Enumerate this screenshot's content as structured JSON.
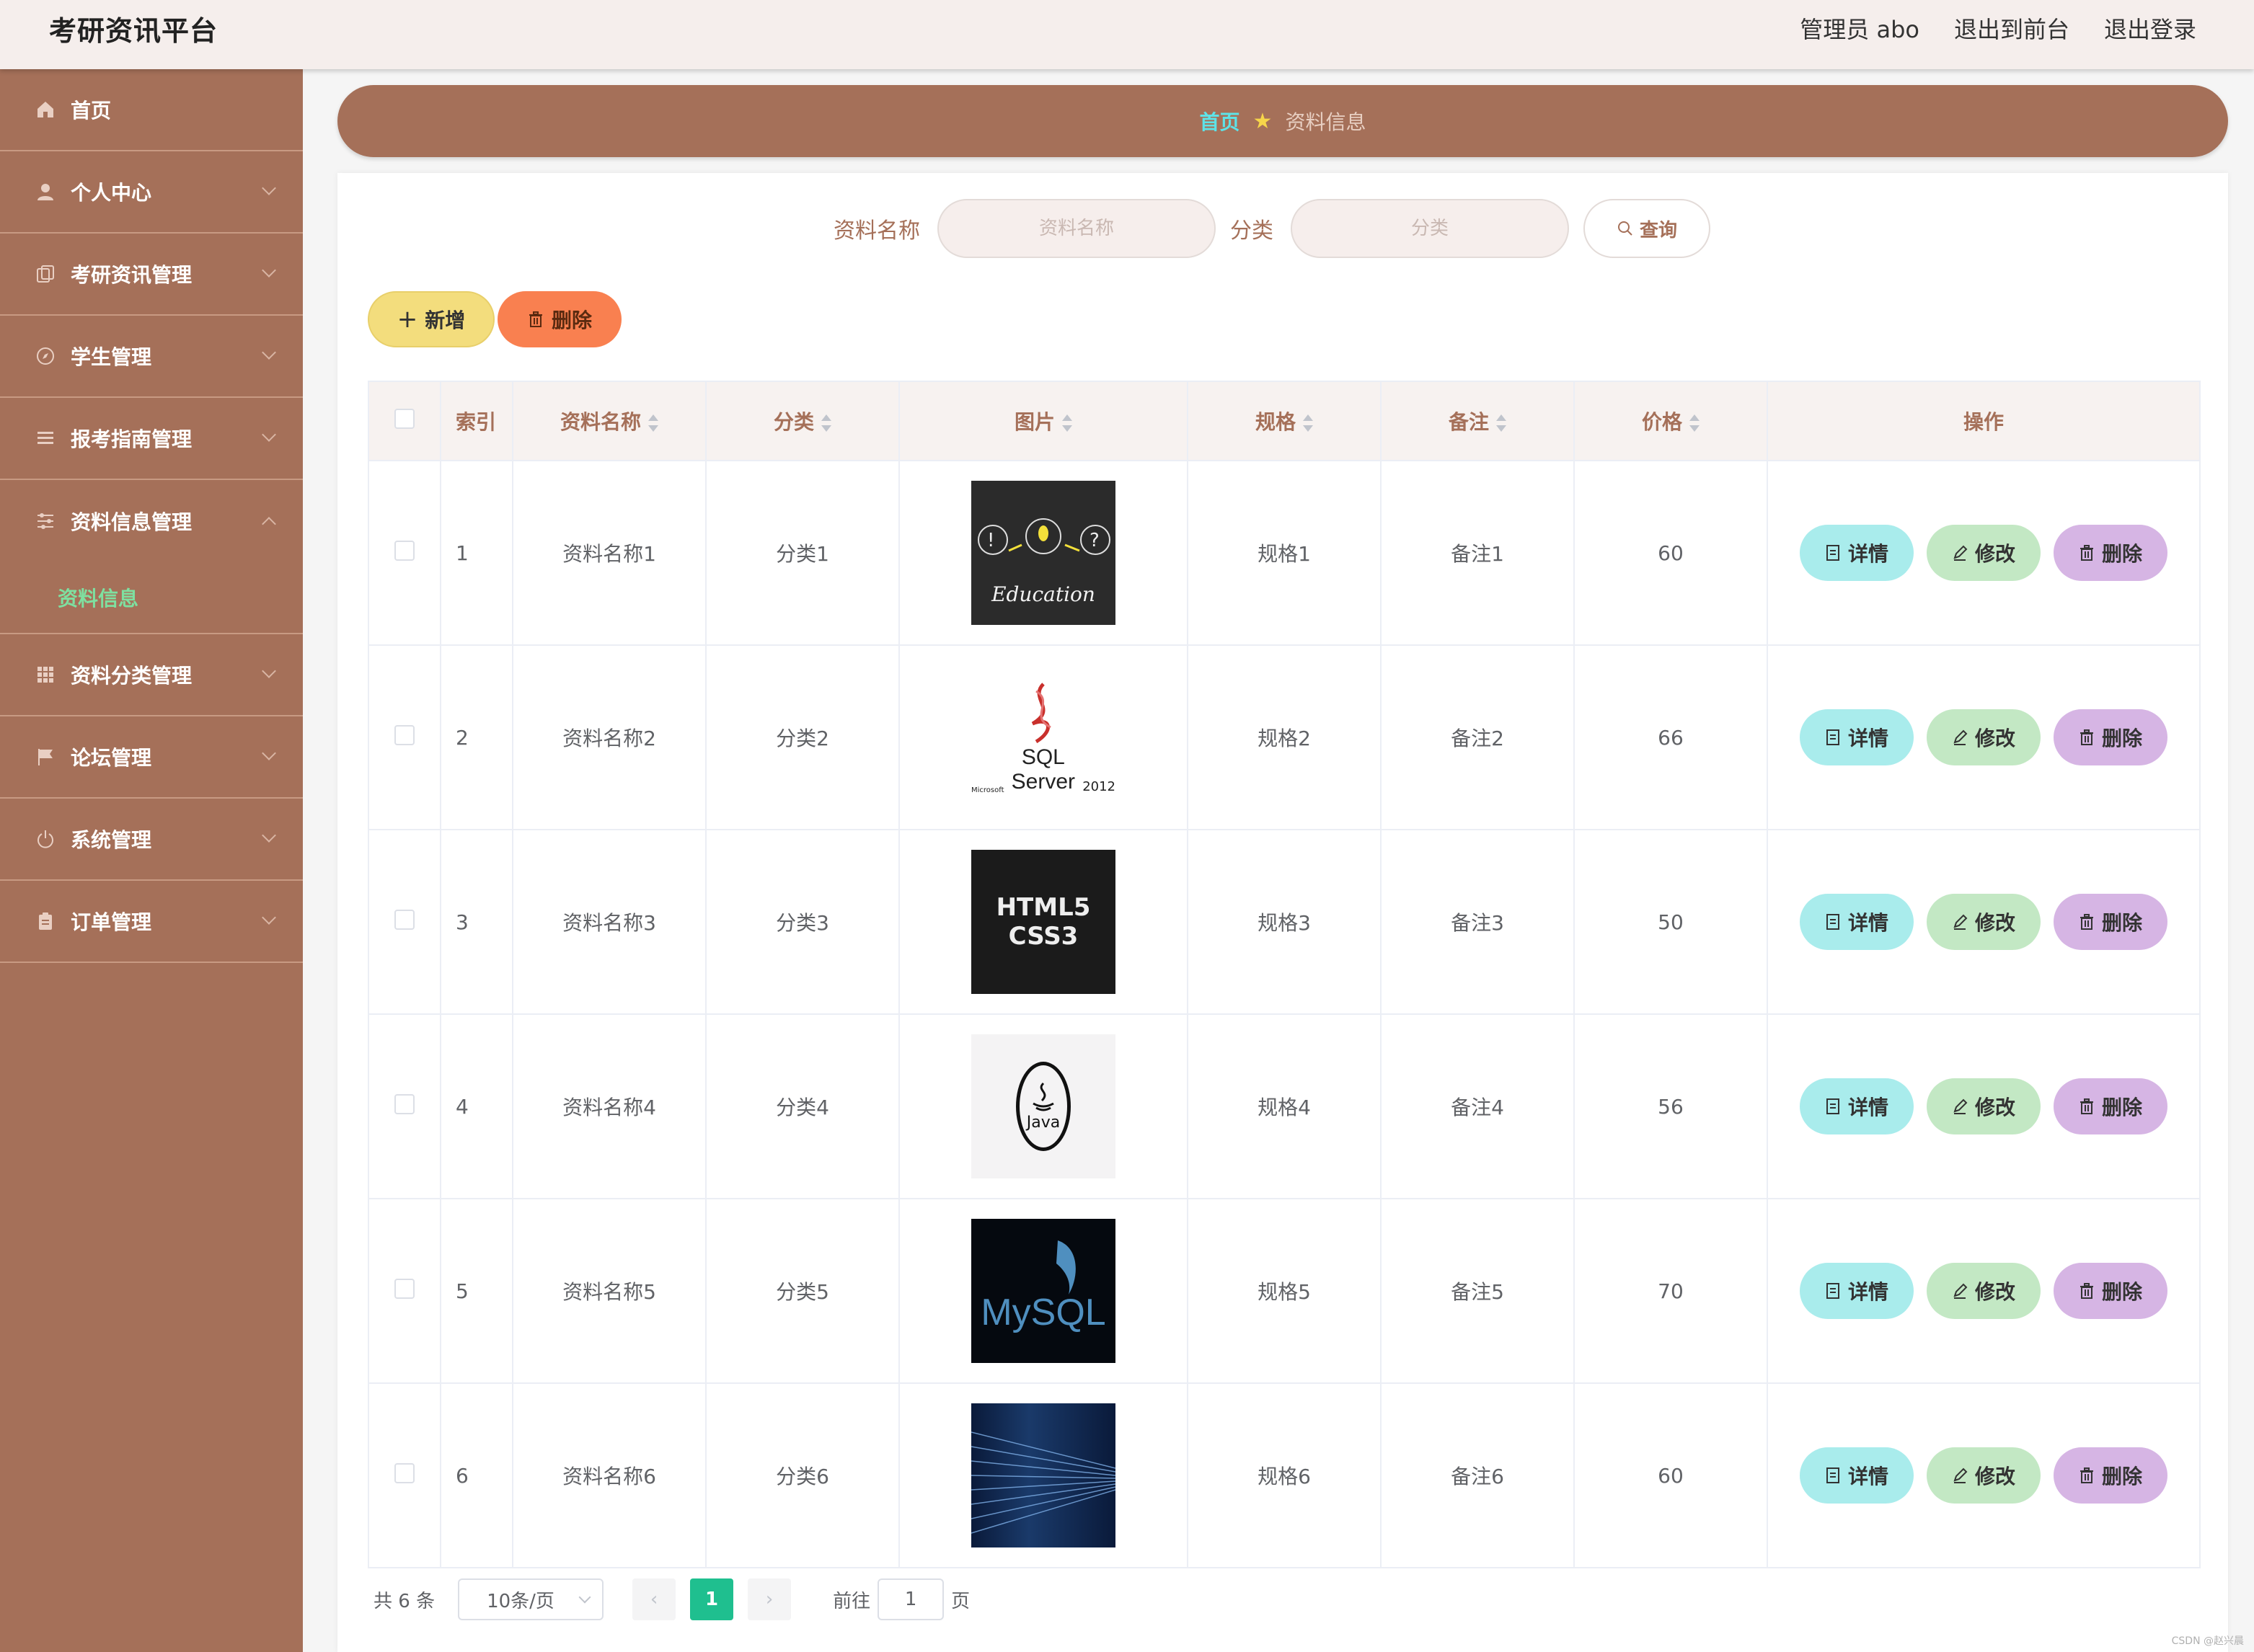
{
  "header": {
    "brand": "考研资讯平台",
    "user_label": "管理员 abo",
    "to_front": "退出到前台",
    "logout": "退出登录"
  },
  "sidebar": {
    "items": [
      {
        "label": "首页",
        "icon": "home-icon"
      },
      {
        "label": "个人中心",
        "icon": "user-icon"
      },
      {
        "label": "考研资讯管理",
        "icon": "copy-icon"
      },
      {
        "label": "学生管理",
        "icon": "compass-icon"
      },
      {
        "label": "报考指南管理",
        "icon": "list-icon"
      },
      {
        "label": "资料信息管理",
        "icon": "sliders-icon"
      },
      {
        "label": "资料分类管理",
        "icon": "grid-icon"
      },
      {
        "label": "论坛管理",
        "icon": "flag-icon"
      },
      {
        "label": "系统管理",
        "icon": "power-icon"
      },
      {
        "label": "订单管理",
        "icon": "clipboard-icon"
      }
    ],
    "submenu_active": "资料信息"
  },
  "breadcrumb": {
    "home": "首页",
    "current": "资料信息"
  },
  "search": {
    "name_label": "资料名称",
    "name_placeholder": "资料名称",
    "category_label": "分类",
    "category_placeholder": "分类",
    "query_button": "查询"
  },
  "toolbar": {
    "add_label": "新增",
    "delete_label": "删除"
  },
  "table": {
    "headers": {
      "index": "索引",
      "name": "资料名称",
      "category": "分类",
      "image": "图片",
      "spec": "规格",
      "remark": "备注",
      "price": "价格",
      "actions": "操作"
    },
    "rows": [
      {
        "index": "1",
        "name": "资料名称1",
        "category": "分类1",
        "image": "education-chalkboard",
        "spec": "规格1",
        "remark": "备注1",
        "price": "60"
      },
      {
        "index": "2",
        "name": "资料名称2",
        "category": "分类2",
        "image": "sql-server-2012-logo",
        "spec": "规格2",
        "remark": "备注2",
        "price": "66"
      },
      {
        "index": "3",
        "name": "资料名称3",
        "category": "分类3",
        "image": "html5-css3-cover",
        "spec": "规格3",
        "remark": "备注3",
        "price": "50"
      },
      {
        "index": "4",
        "name": "资料名称4",
        "category": "分类4",
        "image": "java-logo",
        "spec": "规格4",
        "remark": "备注4",
        "price": "56"
      },
      {
        "index": "5",
        "name": "资料名称5",
        "category": "分类5",
        "image": "mysql-logo",
        "spec": "规格5",
        "remark": "备注5",
        "price": "70"
      },
      {
        "index": "6",
        "name": "资料名称6",
        "category": "分类6",
        "image": "code-stream",
        "spec": "规格6",
        "remark": "备注6",
        "price": "60"
      }
    ],
    "row_actions": {
      "detail": "详情",
      "edit": "修改",
      "delete": "删除"
    }
  },
  "pagination": {
    "total": "共 6 条",
    "page_size": "10条/页",
    "current_page": "1",
    "goto_label": "前往",
    "goto_value": "1",
    "page_suffix": "页"
  },
  "image_texts": {
    "education": "Education",
    "sql_small": "Microsoft",
    "sql_main": "SQL Server",
    "sql_year": "2012",
    "html5": "HTML5",
    "css3": "CSS3",
    "java": "Java",
    "mysql": "MySQL"
  },
  "watermark": "CSDN @赵兴晨",
  "colors": {
    "sidebar_bg": "#a57059",
    "header_bg": "#f5eeec",
    "accent_green": "#1fbf8f",
    "detail_btn": "#a9ecec",
    "edit_btn": "#c3e8c4",
    "delete_btn": "#d6b5e4",
    "add_btn": "#f3dd7d",
    "batch_delete_btn": "#f98050"
  }
}
